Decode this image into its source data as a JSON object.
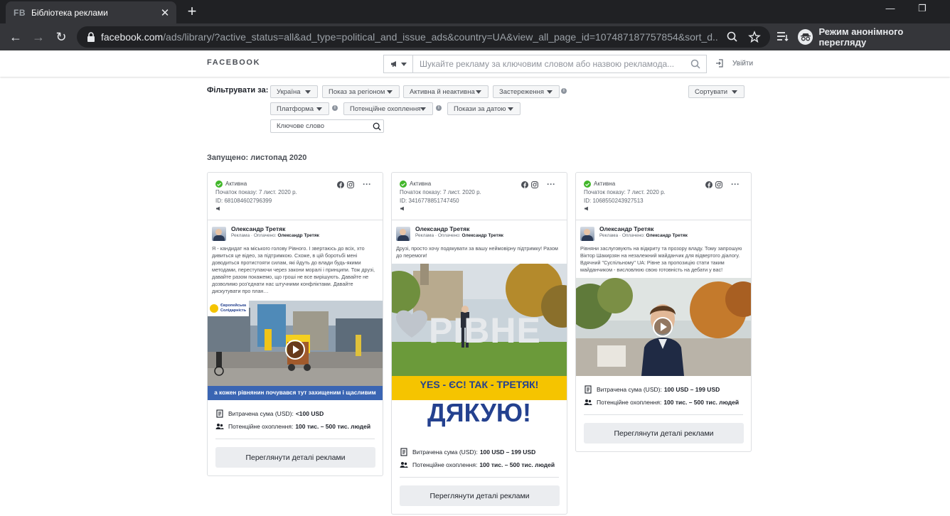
{
  "browser": {
    "tab_favicon": "FB",
    "tab_title": "Бібліотека реклами",
    "url_host": "facebook.com",
    "url_path": "/ads/library/?active_status=all&ad_type=political_and_issue_ads&country=UA&view_all_page_id=107487187757854&sort_d...",
    "incognito_label": "Режим анонімного перегляду"
  },
  "header": {
    "logo": "FACEBOOK",
    "search_placeholder": "Шукайте рекламу за ключовим словом або назвою рекламода...",
    "login": "Увійти"
  },
  "filters": {
    "label": "Фільтрувати за:",
    "country": "Україна",
    "region": "Показ за регіоном",
    "status": "Активна й неактивна",
    "disclaimer": "Застереження",
    "sort": "Сортувати",
    "platform": "Платформа",
    "reach": "Потенційне охоплення",
    "date": "Покази за датою",
    "keyword_placeholder": "Ключове слово"
  },
  "launched_label": "Запущено: листопад 2020",
  "cards": [
    {
      "status": "Активна",
      "start": "Початок показу: 7 лист. 2020 р.",
      "id": "ID: 681084602796399",
      "advertiser": "Олександр Третяк",
      "sponsor_prefix": "Реклама · Оплачено: ",
      "sponsor_name": "Олександр Третяк",
      "text": "Я - кандидат на міського голову Рівного. І звертаюсь до всіх, хто дивиться це відео, за підтримкою. Схоже, в цій боротьбі мені доводиться протистояти силам, які йдуть до влади будь-якими методами, переступаючи через закони моралі і принципи. Тож друзі, давайте разом покажемо, що гроші не все вирішують. Давайте не дозволимо роз'єднати нас штучними конфліктами. Давайте дискутувати про план…",
      "media_caption": "а кожен рівнянин почувався тут захищеним і щасливим",
      "media_badge": "Європейська Солідарність",
      "spend_label": "Витрачена сума (USD):",
      "spend_value": "<100 USD",
      "reach_label": "Потенційне охоплення:",
      "reach_value": "100 тис. – 500 тис. людей",
      "button": "Переглянути деталі реклами"
    },
    {
      "status": "Активна",
      "start": "Початок показу: 7 лист. 2020 р.",
      "id": "ID: 3416778851747450",
      "advertiser": "Олександр Третяк",
      "sponsor_prefix": "Реклама · Оплачено: ",
      "sponsor_name": "Олександр Третяк",
      "text": "Друзі, просто хочу подякувати за вашу неймовірну підтримку! Разом до перемоги!",
      "media_sign": "РІВНЕ",
      "media_banner": "YES - ЄС! ТАК - ТРЕТЯК!",
      "media_thanks": "ДЯКУЮ!",
      "spend_label": "Витрачена сума (USD):",
      "spend_value": "100 USD – 199 USD",
      "reach_label": "Потенційне охоплення:",
      "reach_value": "100 тис. – 500 тис. людей",
      "button": "Переглянути деталі реклами"
    },
    {
      "status": "Активна",
      "start": "Початок показу: 7 лист. 2020 р.",
      "id": "ID: 1068550243927513",
      "advertiser": "Олександр Третяк",
      "sponsor_prefix": "Реклама · Оплачено: ",
      "sponsor_name": "Олександр Третяк",
      "text": "Рівняни заслуговують на відкриту та прозору владу. Тому запрошую Віктор Шакирзян на незалежний майданчик для відвертого діалогу. Вдячний \"Суспільному\" UA: Рівне за пропозицію стати таким майданчиком - висловлюю свою готовність на дебати у вас!",
      "spend_label": "Витрачена сума (USD):",
      "spend_value": "100 USD – 199 USD",
      "reach_label": "Потенційне охоплення:",
      "reach_value": "100 тис. – 500 тис. людей",
      "button": "Переглянути деталі реклами"
    }
  ],
  "colors": {
    "chrome_dark": "#202124",
    "chrome_toolbar": "#35363a",
    "active_green": "#42b72a",
    "banner_yellow": "#f5c400",
    "thanks_blue": "#24418f"
  }
}
